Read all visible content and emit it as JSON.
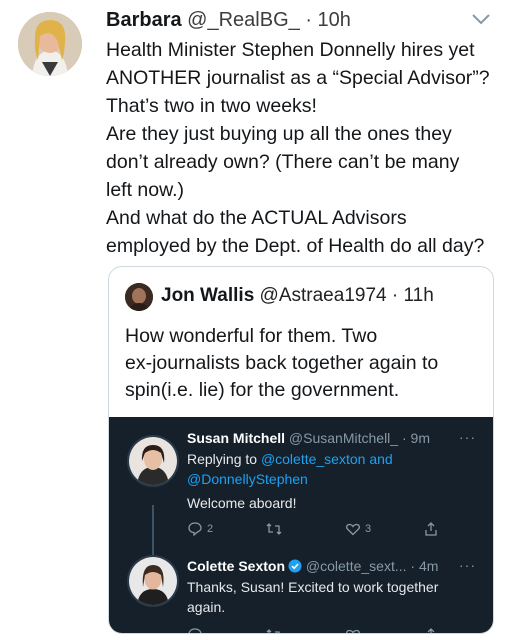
{
  "tweet": {
    "author_name": "Barbara",
    "author_handle": "@_RealBG_",
    "separator": "·",
    "time": "10h",
    "lines": [
      "Health Minister Stephen Donnelly hires yet",
      "ANOTHER journalist as a “Special Advisor”?",
      "That’s two in two weeks!",
      "Are they just buying up all the ones they",
      "don’t already own? (There can’t be many",
      "left now.)",
      "And what do the ACTUAL Advisors",
      "employed by the Dept. of Health do all day?"
    ]
  },
  "quoted": {
    "author_name": "Jon Wallis",
    "author_handle": "@Astraea1974",
    "separator": "·",
    "time": "11h",
    "lines": [
      "How wonderful for them. Two",
      "ex-journalists back together again to",
      "spin(i.e. lie) for the government."
    ],
    "screenshot": {
      "reply1": {
        "name": "Susan Mitchell",
        "handle": "@SusanMitchell_",
        "separator": "·",
        "time": "9m",
        "more": "···",
        "replying_prefix": "Replying to",
        "mention1": "@colette_sexton",
        "and_word": "and",
        "mention2": "@DonnellyStephen",
        "text": "Welcome aboard!",
        "reply_count": "2",
        "like_count": "3"
      },
      "reply2": {
        "name": "Colette Sexton",
        "handle": "@colette_sext...",
        "separator": "·",
        "time": "4m",
        "more": "···",
        "line1": "Thanks, Susan! Excited to work together",
        "line2": "again."
      }
    }
  }
}
